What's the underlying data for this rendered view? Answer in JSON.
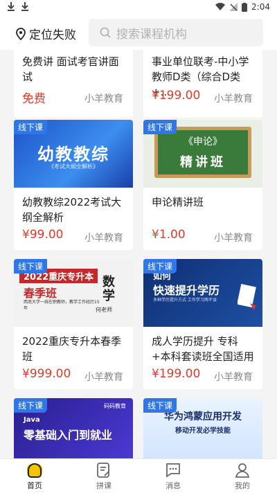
{
  "status": {
    "time": "2:04"
  },
  "header": {
    "location_label": "定位失败",
    "search_placeholder": "搜索课程机构"
  },
  "cards": [
    {
      "badge": "",
      "title": "免费讲 面试考官讲面试",
      "price": "免费",
      "org": "小羊教育"
    },
    {
      "badge": "",
      "title": "事业单位联考-中小学教师D类（综合D类+...",
      "price": "¥199.00",
      "org": "小羊教育"
    },
    {
      "badge": "线下课",
      "title": "幼教教综2022考试大纲全解析",
      "price": "¥99.00",
      "org": "小羊教育",
      "thumb": {
        "main": "幼教教综",
        "sub": "《考试大纲全解析》"
      }
    },
    {
      "badge": "线下课",
      "title": "申论精讲班",
      "price": "¥1.00",
      "org": "小羊教育",
      "thumb": {
        "main": "《申论》",
        "sub": "精讲班"
      }
    },
    {
      "badge": "线下课",
      "title": "2022重庆专升本春季班",
      "price": "¥999.00",
      "org": "小羊教育",
      "thumb": {
        "main": "2022重庆专升本",
        "sub": "春季班",
        "side": "数学",
        "note": "西南大学一线在职教师，教学工作经历15年",
        "teacher": "何老师"
      }
    },
    {
      "badge": "线下课",
      "title": "成人学历提升 专科+本科套读班全国适用",
      "price": "¥199.00",
      "org": "小羊教育",
      "thumb": {
        "main": "快速提升学历",
        "sub": "多种学历提升方式 工作学习两不误",
        "top": "如何"
      }
    },
    {
      "badge": "线下课",
      "title": "",
      "price": "",
      "org": "",
      "thumb": {
        "main": "零基础入门到就业",
        "sub": "Java",
        "brand": "码码教育"
      }
    },
    {
      "badge": "线下课",
      "title": "",
      "price": "",
      "org": "",
      "thumb": {
        "main": "华为鸿蒙应用开发",
        "sub": "移动开发必学技能"
      }
    }
  ],
  "tabbar": [
    {
      "label": "首页",
      "icon": "home-icon",
      "active": true
    },
    {
      "label": "拼课",
      "icon": "document-icon",
      "active": false
    },
    {
      "label": "消息",
      "icon": "message-icon",
      "active": false
    },
    {
      "label": "我的",
      "icon": "profile-icon",
      "active": false
    }
  ],
  "colors": {
    "price": "#e03a2b",
    "badge": "#2f76e8",
    "tab_active": "#f5c400"
  }
}
